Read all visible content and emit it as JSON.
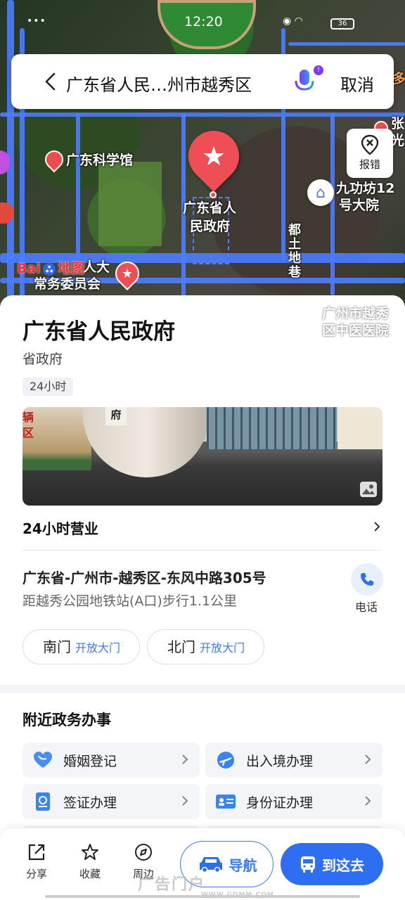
{
  "status_bar": {
    "time": "12:20",
    "left": "••• ",
    "battery": "36"
  },
  "search": {
    "query": "广东省人民…州市越秀区",
    "cancel": "取消"
  },
  "map": {
    "labels": {
      "science_hall": "广东科学馆",
      "poi_main": "广东省人\n民政府",
      "poi_main_1": "广东省人",
      "poi_main_2": "民政府",
      "nine_1": "九功坊12",
      "nine_2": "号大院",
      "npc_1": "人大",
      "npc_2": "常务委员会",
      "road_vert": "都土地巷",
      "hospital_1": "广州市越秀",
      "hospital_2": "区中医医院",
      "top_right_1": "张",
      "top_right_2": "光",
      "edge_right": "多"
    },
    "report_label": "报错",
    "logo_text": "地图"
  },
  "place": {
    "name": "广东省人民政府",
    "category": "省政府",
    "tag": "24小时",
    "hours": "24小时营业",
    "address": "广东省-广州市-越秀区-东风中路305号",
    "distance": "距越秀公园地铁站(A口)步行1.1公里",
    "phone_label": "电话",
    "photo_sign": "府",
    "photo_sign2": "辆区"
  },
  "gates": [
    {
      "name": "南门",
      "desc": "开放大门"
    },
    {
      "name": "北门",
      "desc": "开放大门"
    }
  ],
  "services": {
    "title": "附近政务办事",
    "items": [
      {
        "label": "婚姻登记",
        "color": "#4a8cf5"
      },
      {
        "label": "出入境办理",
        "color": "#3a84f0"
      },
      {
        "label": "签证办理",
        "color": "#3a84f0"
      },
      {
        "label": "身份证办理",
        "color": "#3a84f0"
      },
      {
        "label": "",
        "color": "#3a84f0"
      },
      {
        "label": "",
        "color": "#3a84f0"
      }
    ]
  },
  "bottom": {
    "share": "分享",
    "favorite": "收藏",
    "nearby": "周边",
    "navigate": "导航",
    "go_here": "到这去",
    "watermark": "广告门户",
    "watermark_url": "WWW.GDMM.COM"
  },
  "colors": {
    "accent": "#2e6ff2",
    "poi_red": "#f04e55"
  }
}
